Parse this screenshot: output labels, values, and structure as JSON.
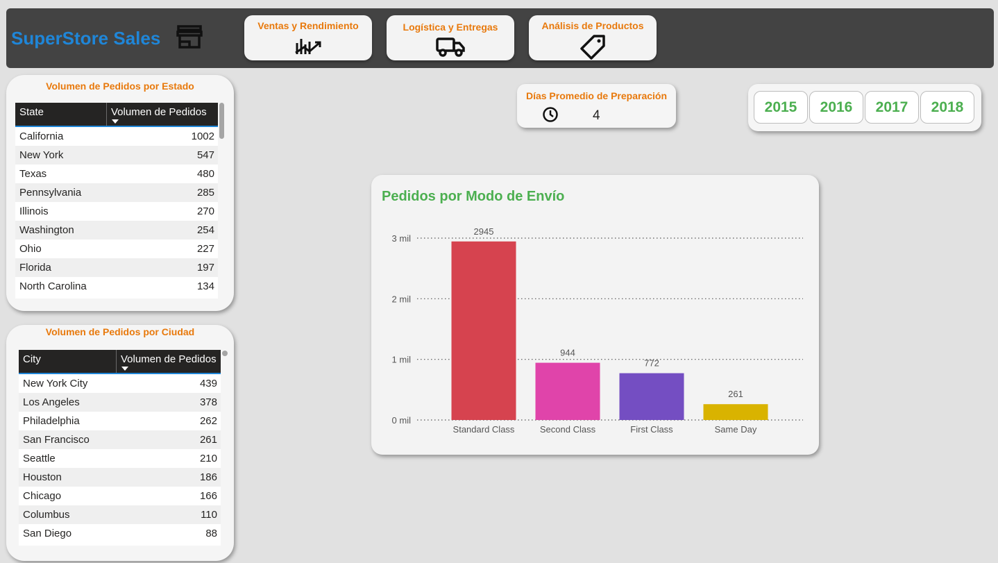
{
  "header": {
    "brand": "SuperStore Sales",
    "nav": [
      {
        "label": "Ventas y Rendimiento",
        "icon": "chart-trend-icon"
      },
      {
        "label": "Logística y Entregas",
        "icon": "truck-icon"
      },
      {
        "label": "Análisis de Productos",
        "icon": "price-tag-icon"
      }
    ]
  },
  "state_table": {
    "title": "Volumen de Pedidos por Estado",
    "col1": "State",
    "col2": "Volumen de Pedidos",
    "rows": [
      {
        "name": "California",
        "value": "1002"
      },
      {
        "name": "New York",
        "value": "547"
      },
      {
        "name": "Texas",
        "value": "480"
      },
      {
        "name": "Pennsylvania",
        "value": "285"
      },
      {
        "name": "Illinois",
        "value": "270"
      },
      {
        "name": "Washington",
        "value": "254"
      },
      {
        "name": "Ohio",
        "value": "227"
      },
      {
        "name": "Florida",
        "value": "197"
      },
      {
        "name": "North Carolina",
        "value": "134"
      }
    ]
  },
  "city_table": {
    "title": "Volumen de Pedidos por Ciudad",
    "col1": "City",
    "col2": "Volumen de Pedidos",
    "rows": [
      {
        "name": "New York City",
        "value": "439"
      },
      {
        "name": "Los Angeles",
        "value": "378"
      },
      {
        "name": "Philadelphia",
        "value": "262"
      },
      {
        "name": "San Francisco",
        "value": "261"
      },
      {
        "name": "Seattle",
        "value": "210"
      },
      {
        "name": "Houston",
        "value": "186"
      },
      {
        "name": "Chicago",
        "value": "166"
      },
      {
        "name": "Columbus",
        "value": "110"
      },
      {
        "name": "San Diego",
        "value": "88"
      }
    ]
  },
  "kpi": {
    "title": "Días Promedio de Preparación",
    "value": "4",
    "icon": "clock-icon"
  },
  "years": [
    "2015",
    "2016",
    "2017",
    "2018"
  ],
  "chart_data": {
    "type": "bar",
    "title": "Pedidos por Modo de Envío",
    "categories": [
      "Standard Class",
      "Second Class",
      "First Class",
      "Same Day"
    ],
    "values": [
      2945,
      944,
      772,
      261
    ],
    "colors": [
      "#d6434f",
      "#e044aa",
      "#744ec2",
      "#d9b300"
    ],
    "ylim": [
      0,
      3000
    ],
    "yticks": [
      0,
      1000,
      2000,
      3000
    ],
    "ytick_labels": [
      "0 mil",
      "1 mil",
      "2 mil",
      "3 mil"
    ],
    "grid": true,
    "xlabel": "",
    "ylabel": ""
  }
}
